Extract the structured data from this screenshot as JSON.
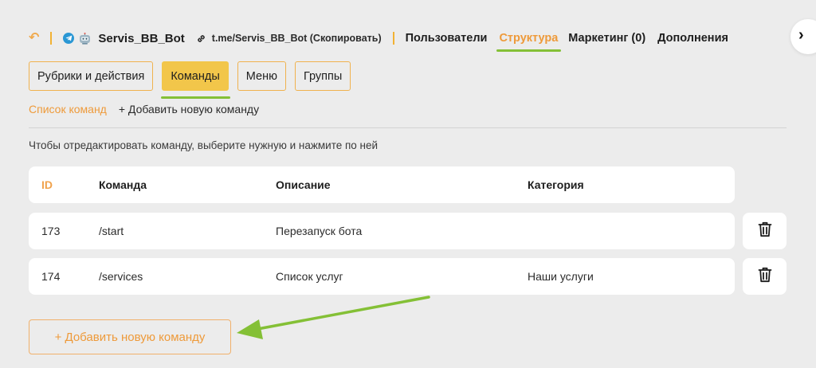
{
  "header": {
    "bot_name": "Servis_BB_Bot",
    "bot_link": "t.me/Servis_BB_Bot (Скопировать)",
    "nav": {
      "users": "Пользователи",
      "structure": "Структура",
      "marketing": "Маркетинг (0)",
      "extras": "Дополнения"
    }
  },
  "tabs": {
    "rubrics": "Рубрики и действия",
    "commands": "Команды",
    "menu": "Меню",
    "groups": "Группы",
    "active": "commands"
  },
  "subnav": {
    "list": "Список команд",
    "add": "+ Добавить новую команду"
  },
  "hint": "Чтобы отредактировать команду, выберите нужную и нажмите по ней",
  "table": {
    "columns": {
      "id": "ID",
      "command": "Команда",
      "description": "Описание",
      "category": "Категория"
    },
    "rows": [
      {
        "id": "173",
        "command": "/start",
        "description": "Перезапуск бота",
        "category": ""
      },
      {
        "id": "174",
        "command": "/services",
        "description": "Список услуг",
        "category": "Наши услуги"
      }
    ]
  },
  "add_button": "+ Добавить новую команду",
  "icons": {
    "back": "back-arrow-icon",
    "telegram": "telegram-icon",
    "bot": "bot-avatar-icon",
    "link": "link-icon",
    "collapse": "chevron-right-icon",
    "delete": "trash-icon"
  },
  "colors": {
    "accent_orange": "#ee9a3a",
    "active_tab": "#f2c64a",
    "tab_border": "#f0b24e",
    "annotation_green": "#84c036",
    "background": "#ececec",
    "telegram_blue": "#2a97d4"
  }
}
